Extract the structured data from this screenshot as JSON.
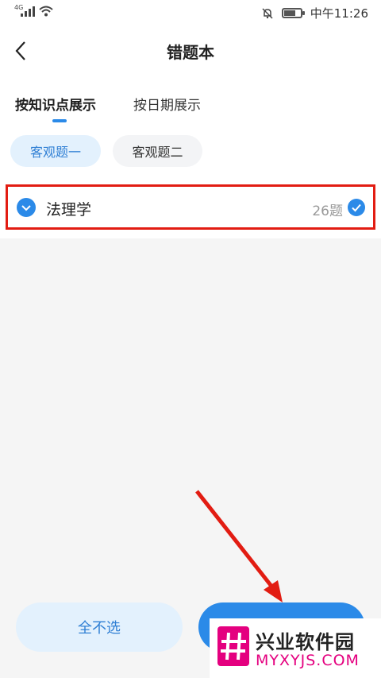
{
  "status_bar": {
    "network": "4G",
    "time": "中午11:26",
    "icons": [
      "signal-icon",
      "wifi-icon",
      "mute-bell-icon",
      "battery-icon"
    ]
  },
  "header": {
    "title": "错题本",
    "back_icon": "chevron-left-icon"
  },
  "tabs": [
    {
      "label": "按知识点展示",
      "active": true
    },
    {
      "label": "按日期展示",
      "active": false
    }
  ],
  "chips": [
    {
      "label": "客观题一",
      "selected": true
    },
    {
      "label": "客观题二",
      "selected": false
    }
  ],
  "list": [
    {
      "label": "法理学",
      "count": "26题",
      "checked": true
    }
  ],
  "footer": {
    "deselect_all": "全不选"
  },
  "watermark": {
    "name": "兴业软件园",
    "url": "MYXYJS.COM"
  },
  "colors": {
    "accent": "#2b8ae8",
    "chip_bg": "#e3f1fd",
    "highlight_border": "#e21c12",
    "watermark_url": "#e4007f"
  }
}
